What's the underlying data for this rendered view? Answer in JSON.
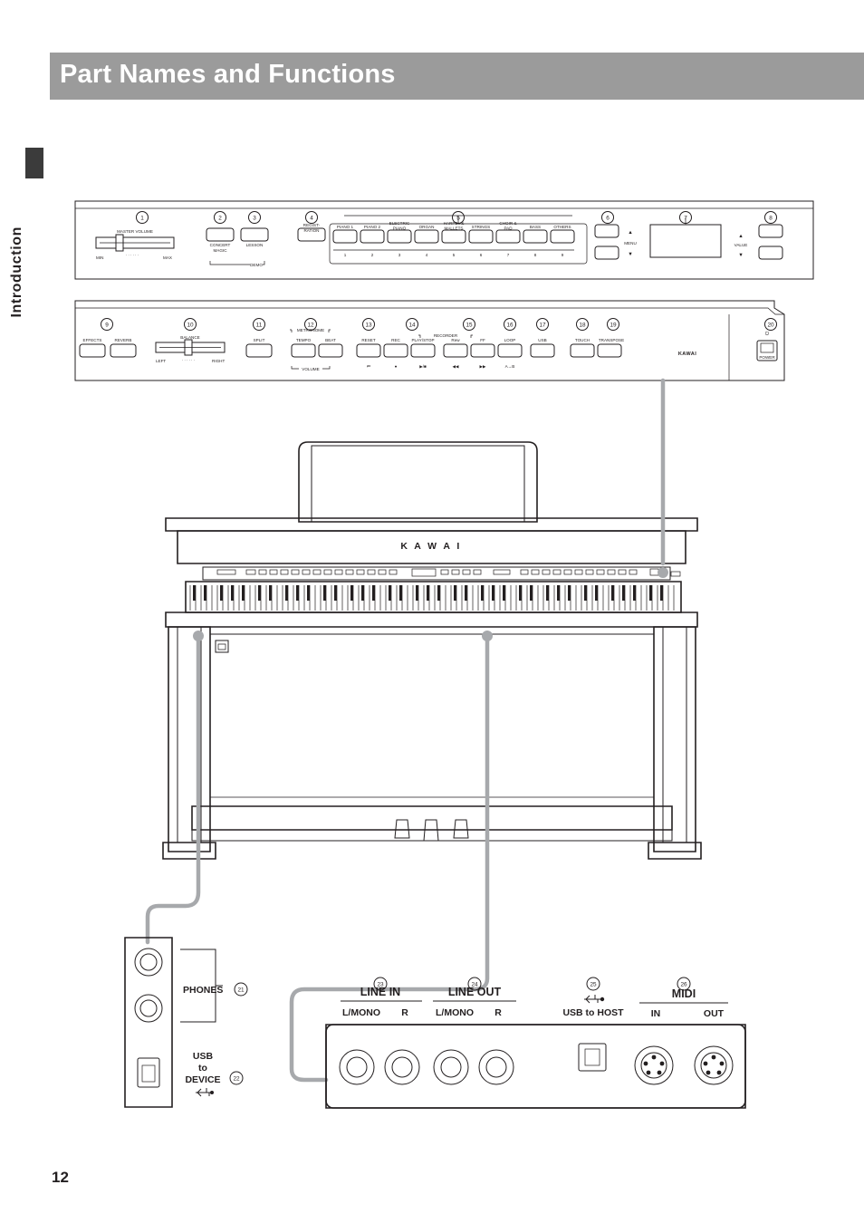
{
  "header": {
    "title": "Part Names and Functions"
  },
  "sidebar": {
    "section_label": "Introduction"
  },
  "page": {
    "number": "12"
  },
  "panel_top": {
    "master_volume": {
      "number": "1",
      "label": "MASTER VOLUME",
      "min": "MIN",
      "max": "MAX"
    },
    "buttons": [
      {
        "number": "2",
        "label_line1": "CONCERT",
        "label_line2": "MAGIC"
      },
      {
        "number": "3",
        "label_line1": "LESSON",
        "label_line2": ""
      }
    ],
    "demo_label": "DEMO",
    "registration": {
      "number": "4",
      "label_line1": "REGIST-",
      "label_line2": "RATION"
    },
    "sound_group": {
      "number": "5",
      "buttons": [
        {
          "label_line1": "PIANO 1",
          "label_line2": "",
          "index": "1"
        },
        {
          "label_line1": "PIANO 2",
          "label_line2": "",
          "index": "2"
        },
        {
          "label_line1": "ELECTRIC",
          "label_line2": "PIANO",
          "index": "3"
        },
        {
          "label_line1": "ORGAN",
          "label_line2": "",
          "index": "4"
        },
        {
          "label_line1": "HARPSI. &",
          "label_line2": "MALLETS",
          "index": "5"
        },
        {
          "label_line1": "STRINGS",
          "label_line2": "",
          "index": "6"
        },
        {
          "label_line1": "CHOIR &",
          "label_line2": "PAD",
          "index": "7"
        },
        {
          "label_line1": "BASS",
          "label_line2": "",
          "index": "8"
        },
        {
          "label_line1": "OTHERS",
          "label_line2": "",
          "index": "9"
        }
      ]
    },
    "menu": {
      "number": "6",
      "label": "MENU",
      "up": "▲",
      "down": "▼"
    },
    "display": {
      "number": "7"
    },
    "value": {
      "number": "8",
      "label": "VALUE",
      "up": "▲",
      "down": "▼"
    }
  },
  "panel_bottom": {
    "effects_reverb": {
      "number": "9",
      "buttons": [
        {
          "label": "EFFECTS"
        },
        {
          "label": "REVERB"
        }
      ]
    },
    "balance": {
      "number": "10",
      "label": "BALANCE",
      "left": "LEFT",
      "right": "RIGHT"
    },
    "split": {
      "number": "11",
      "label": "SPLIT"
    },
    "metronome": {
      "number": "12",
      "group_label": "METRONOME",
      "volume_label": "VOLUME",
      "buttons": [
        {
          "label": "TEMPO"
        },
        {
          "label": "BEAT"
        }
      ]
    },
    "recorder": {
      "group_label": "RECORDER",
      "items": [
        {
          "number": "13",
          "label": "RESET",
          "glyph": "⏮"
        },
        {
          "number": "14",
          "label": "REC",
          "glyph": "●"
        },
        {
          "number": "",
          "label": "PLAY/STOP",
          "glyph": "▶/■"
        },
        {
          "number": "15",
          "label": "Rew",
          "glyph": "◀◀"
        },
        {
          "number": "",
          "label": "FF",
          "glyph": "▶▶"
        },
        {
          "number": "16",
          "label": "LOOP",
          "glyph": "A→B"
        }
      ]
    },
    "usb": {
      "number": "17",
      "label": "USB"
    },
    "touch": {
      "number": "18",
      "label": "TOUCH"
    },
    "transpose": {
      "number": "19",
      "label": "TRANSPOSE"
    },
    "logo": {
      "label": "KAWAI"
    },
    "power": {
      "number": "20",
      "label": "POWER",
      "glyph": "⏻"
    }
  },
  "instrument": {
    "brand": "K A W A I"
  },
  "jacks_left": {
    "phones": {
      "label": "PHONES",
      "number": "21"
    },
    "usb_to_device": {
      "line1": "USB",
      "line2": "to",
      "line3": "DEVICE",
      "number": "22"
    }
  },
  "jacks_rear": {
    "line_in": {
      "number": "23",
      "label": "LINE IN",
      "sub_left": "L/MONO",
      "sub_right": "R"
    },
    "line_out": {
      "number": "24",
      "label": "LINE OUT",
      "sub_left": "L/MONO",
      "sub_right": "R"
    },
    "usb_to_host": {
      "number": "25",
      "label": "USB to HOST"
    },
    "midi": {
      "number": "26",
      "label": "MIDI",
      "in": "IN",
      "out": "OUT"
    }
  },
  "colors": {
    "header_bg": "#9b9b9b",
    "ink": "#231f20",
    "cable": "#a7a9ac"
  }
}
